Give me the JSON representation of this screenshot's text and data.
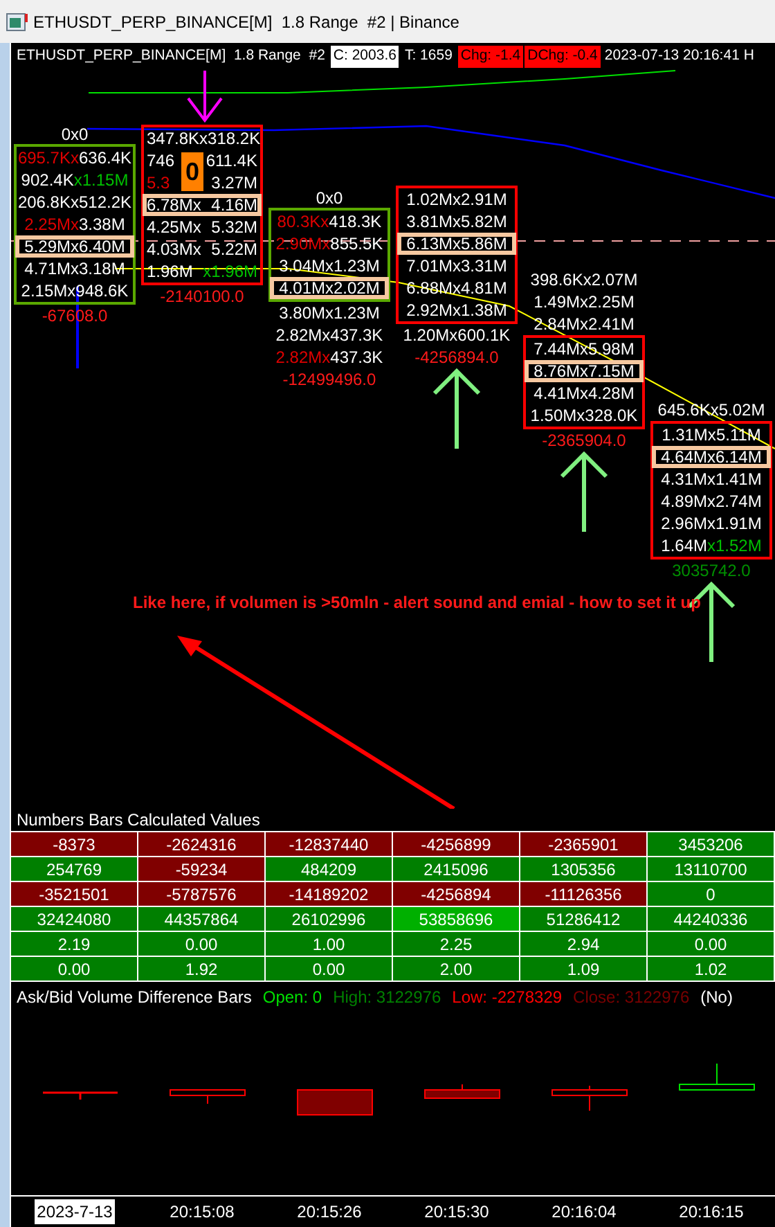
{
  "window": {
    "title": "ETHUSDT_PERP_BINANCE[M]  1.8 Range  #2 | Binance"
  },
  "chart_header": {
    "symbol": "ETHUSDT_PERP_BINANCE[M]  1.8 Range  #2",
    "close": "C: 2003.6",
    "ticks": "T: 1659",
    "change": "Chg: -1.4",
    "daily_change": "DChg: -0.4",
    "datetime": "2023-07-13 20:16:41 H"
  },
  "footprint_bars": [
    {
      "header": "0x0",
      "color": "#5aa800",
      "arrow": false,
      "total": "-67608.0",
      "gain": false,
      "boxed": [
        {
          "bid": "695.7Kx",
          "ask": "636.4K",
          "bid_red": true,
          "ask_green": false,
          "poc": false
        },
        {
          "bid": "902.4K",
          "ask": "x1.15M",
          "bid_red": false,
          "ask_green": true,
          "poc": false
        },
        {
          "bid": "206.8Kx",
          "ask": "512.2K",
          "bid_red": false,
          "ask_green": false,
          "poc": false
        },
        {
          "bid": "2.25Mx",
          "ask": "3.38M",
          "bid_red": true,
          "ask_green": false,
          "poc": false
        },
        {
          "bid": "5.29Mx",
          "ask": "6.40M",
          "bid_red": false,
          "ask_green": false,
          "poc": true
        },
        {
          "bid": "4.71Mx",
          "ask": "3.18M",
          "bid_red": false,
          "ask_green": false,
          "poc": false
        },
        {
          "bid": "2.15Mx",
          "ask": "948.6K",
          "bid_red": false,
          "ask_green": false,
          "poc": false
        }
      ]
    },
    {
      "color": "#ff0000",
      "badge": "0",
      "arrow": false,
      "total": "-2140100.0",
      "gain": false,
      "boxed": [
        {
          "bid": "347.8Kx",
          "ask": "318.2K",
          "bid_red": false,
          "ask_green": false,
          "poc": false
        },
        {
          "bid": "746",
          "ask": "611.4K",
          "bid_red": false,
          "ask_green": false,
          "poc": false
        },
        {
          "bid": "5.3",
          "ask": "3.27M",
          "bid_red": true,
          "ask_green": false,
          "poc": false
        },
        {
          "bid": "6.78Mx",
          "ask": "4.16M",
          "bid_red": false,
          "ask_green": false,
          "poc": true
        },
        {
          "bid": "4.25Mx",
          "ask": "5.32M",
          "bid_red": false,
          "ask_green": false,
          "poc": false
        },
        {
          "bid": "4.03Mx",
          "ask": "5.22M",
          "bid_red": false,
          "ask_green": false,
          "poc": false
        },
        {
          "bid": "1.96M",
          "ask": "x1.96M",
          "bid_red": false,
          "ask_green": true,
          "poc": false
        }
      ]
    },
    {
      "header": "0x0",
      "color": "#5aa800",
      "arrow": false,
      "total": "-12499496.0",
      "gain": false,
      "boxed": [
        {
          "bid": "80.3Kx",
          "ask": "418.3K",
          "bid_red": true,
          "ask_green": false,
          "poc": false
        },
        {
          "bid": "2.90Mx",
          "ask": "855.5K",
          "bid_red": true,
          "ask_green": false,
          "poc": false
        },
        {
          "bid": "3.04Mx",
          "ask": "1.23M",
          "bid_red": false,
          "ask_green": false,
          "poc": false
        },
        {
          "bid": "4.01Mx",
          "ask": "2.02M",
          "bid_red": false,
          "ask_green": false,
          "poc": true
        }
      ],
      "below": [
        {
          "bid": "3.80Mx",
          "ask": "1.23M",
          "bid_red": false,
          "ask_green": false,
          "poc": false
        },
        {
          "bid": "2.82Mx",
          "ask": "437.3K",
          "bid_red": false,
          "ask_green": false,
          "poc": false
        },
        {
          "bid": "2.82Mx",
          "ask": "437.3K",
          "bid_red": true,
          "ask_green": false,
          "poc": false
        }
      ]
    },
    {
      "color": "#ff0000",
      "arrow": true,
      "total": "-4256894.0",
      "gain": false,
      "boxed": [
        {
          "bid": "1.02Mx",
          "ask": "2.91M",
          "bid_red": false,
          "ask_green": false,
          "poc": false
        },
        {
          "bid": "3.81Mx",
          "ask": "5.82M",
          "bid_red": false,
          "ask_green": false,
          "poc": false
        },
        {
          "bid": "6.13Mx",
          "ask": "5.86M",
          "bid_red": false,
          "ask_green": false,
          "poc": true
        },
        {
          "bid": "7.01Mx",
          "ask": "3.31M",
          "bid_red": false,
          "ask_green": false,
          "poc": false
        },
        {
          "bid": "6.88Mx",
          "ask": "4.81M",
          "bid_red": false,
          "ask_green": false,
          "poc": false
        },
        {
          "bid": "2.92Mx",
          "ask": "1.38M",
          "bid_red": false,
          "ask_green": false,
          "poc": false
        }
      ],
      "below": [
        {
          "bid": "1.20Mx",
          "ask": "600.1K",
          "bid_red": false,
          "ask_green": false,
          "poc": false
        }
      ]
    },
    {
      "color": "#ff0000",
      "arrow": true,
      "total": "-2365904.0",
      "gain": false,
      "above": [
        {
          "bid": "398.6Kx",
          "ask": "2.07M",
          "bid_red": false,
          "ask_green": false,
          "poc": false
        },
        {
          "bid": "1.49Mx",
          "ask": "2.25M",
          "bid_red": false,
          "ask_green": false,
          "poc": false
        },
        {
          "bid": "2.84Mx",
          "ask": "2.41M",
          "bid_red": false,
          "ask_green": false,
          "poc": false
        }
      ],
      "boxed": [
        {
          "bid": "7.44Mx",
          "ask": "5.98M",
          "bid_red": false,
          "ask_green": false,
          "poc": false
        },
        {
          "bid": "8.76Mx",
          "ask": "7.15M",
          "bid_red": false,
          "ask_green": false,
          "poc": true
        },
        {
          "bid": "4.41Mx",
          "ask": "4.28M",
          "bid_red": false,
          "ask_green": false,
          "poc": false
        },
        {
          "bid": "1.50Mx",
          "ask": "328.0K",
          "bid_red": false,
          "ask_green": false,
          "poc": false
        }
      ]
    },
    {
      "color": "#ff0000",
      "arrow": true,
      "total": "3035742.0",
      "gain": true,
      "above": [
        {
          "bid": "645.6Kx",
          "ask": "5.02M",
          "bid_red": false,
          "ask_green": false,
          "poc": false
        }
      ],
      "boxed": [
        {
          "bid": "1.31Mx",
          "ask": "5.11M",
          "bid_red": false,
          "ask_green": false,
          "poc": false
        },
        {
          "bid": "4.64Mx",
          "ask": "6.14M",
          "bid_red": false,
          "ask_green": false,
          "poc": true
        },
        {
          "bid": "4.31Mx",
          "ask": "1.41M",
          "bid_red": false,
          "ask_green": false,
          "poc": false
        },
        {
          "bid": "4.89Mx",
          "ask": "2.74M",
          "bid_red": false,
          "ask_green": false,
          "poc": false
        },
        {
          "bid": "2.96Mx",
          "ask": "1.91M",
          "bid_red": false,
          "ask_green": false,
          "poc": false
        },
        {
          "bid": "1.64M",
          "ask": "x1.52M",
          "bid_red": false,
          "ask_green": true,
          "poc": false
        }
      ]
    }
  ],
  "annotation": "Like here, if volumen is >50mln - alert sound and emial - how to set it up",
  "values_table": {
    "title": "Numbers Bars Calculated Values",
    "rows": [
      [
        {
          "text": "-8373",
          "color": "#800000"
        },
        {
          "text": "-2624316",
          "color": "#800000"
        },
        {
          "text": "-12837440",
          "color": "#800000"
        },
        {
          "text": "-4256899",
          "color": "#800000"
        },
        {
          "text": "-2365901",
          "color": "#800000"
        },
        {
          "text": "3453206",
          "color": "#007f00"
        }
      ],
      [
        {
          "text": "254769",
          "color": "#007f00"
        },
        {
          "text": "-59234",
          "color": "#800000"
        },
        {
          "text": "484209",
          "color": "#007f00"
        },
        {
          "text": "2415096",
          "color": "#007f00"
        },
        {
          "text": "1305356",
          "color": "#007f00"
        },
        {
          "text": "13110700",
          "color": "#007f00"
        }
      ],
      [
        {
          "text": "-3521501",
          "color": "#800000"
        },
        {
          "text": "-5787576",
          "color": "#800000"
        },
        {
          "text": "-14189202",
          "color": "#800000"
        },
        {
          "text": "-4256894",
          "color": "#800000"
        },
        {
          "text": "-11126356",
          "color": "#800000"
        },
        {
          "text": "0",
          "color": "#007f00"
        }
      ],
      [
        {
          "text": "32424080",
          "color": "#007f00"
        },
        {
          "text": "44357864",
          "color": "#007f00"
        },
        {
          "text": "26102996",
          "color": "#007f00"
        },
        {
          "text": "53858696",
          "color": "#00b000"
        },
        {
          "text": "51286412",
          "color": "#007f00"
        },
        {
          "text": "44240336",
          "color": "#007f00"
        }
      ],
      [
        {
          "text": "2.19",
          "color": "#007f00"
        },
        {
          "text": "0.00",
          "color": "#007f00"
        },
        {
          "text": "1.00",
          "color": "#007f00"
        },
        {
          "text": "2.25",
          "color": "#007f00"
        },
        {
          "text": "2.94",
          "color": "#007f00"
        },
        {
          "text": "0.00",
          "color": "#007f00"
        }
      ],
      [
        {
          "text": "0.00",
          "color": "#007f00"
        },
        {
          "text": "1.92",
          "color": "#007f00"
        },
        {
          "text": "0.00",
          "color": "#007f00"
        },
        {
          "text": "2.00",
          "color": "#007f00"
        },
        {
          "text": "1.09",
          "color": "#007f00"
        },
        {
          "text": "1.02",
          "color": "#007f00"
        }
      ]
    ]
  },
  "difference_panel": {
    "title": "Ask/Bid Volume Difference Bars",
    "open": "Open: 0",
    "high": "High: 3122976",
    "low": "Low: -2278329",
    "close": "Close: 3122976",
    "flag": "(No)"
  },
  "time_axis": [
    {
      "label": "2023-7-13",
      "selected": true
    },
    {
      "label": "20:15:08",
      "selected": false
    },
    {
      "label": "20:15:26",
      "selected": false
    },
    {
      "label": "20:15:30",
      "selected": false
    },
    {
      "label": "20:16:04",
      "selected": false
    },
    {
      "label": "20:16:15",
      "selected": false
    }
  ]
}
